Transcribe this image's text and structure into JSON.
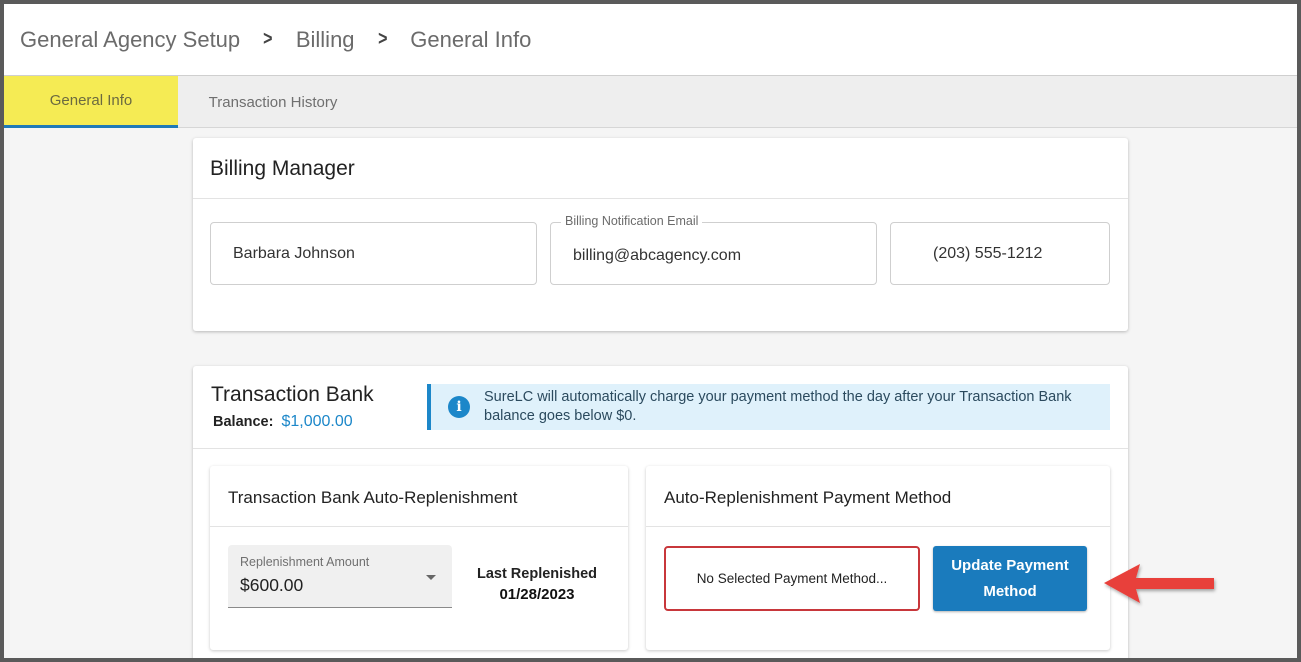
{
  "breadcrumb": {
    "items": [
      "General Agency Setup",
      "Billing",
      "General Info"
    ],
    "separator": ">"
  },
  "tabs": [
    {
      "label": "General Info",
      "active": true
    },
    {
      "label": "Transaction History",
      "active": false
    }
  ],
  "billing_manager": {
    "title": "Billing Manager",
    "name_value": "Barbara Johnson",
    "email_label": "Billing Notification Email",
    "email_value": "billing@abcagency.com",
    "phone_value": "(203) 555-1212"
  },
  "transaction_bank": {
    "title": "Transaction Bank",
    "balance_label": "Balance:",
    "balance_value": "$1,000.00",
    "info_icon": "info-icon",
    "info_text": "SureLC will automatically charge your payment method the day after your Transaction Bank balance goes below $0.",
    "auto_replenishment": {
      "title": "Transaction Bank Auto-Replenishment",
      "amount_label": "Replenishment Amount",
      "amount_value": "$600.00",
      "last_replenished_label": "Last Replenished",
      "last_replenished_value": "01/28/2023"
    },
    "payment_method": {
      "title": "Auto-Replenishment Payment Method",
      "selected_text": "No Selected Payment Method...",
      "update_button_label": "Update Payment Method"
    }
  },
  "colors": {
    "active_tab": "#f5eb54",
    "accent": "#1a7bbd",
    "alert_border": "#c8373b",
    "arrow": "#e8413a"
  }
}
